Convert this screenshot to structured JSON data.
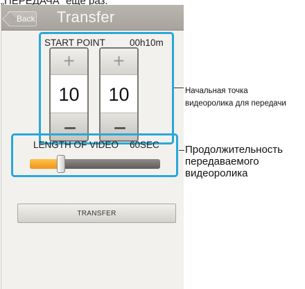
{
  "top_caption": "„ПЕРЕДАЧА“ еще раз.",
  "screen": {
    "title": "Transfer",
    "back_label": "Back",
    "start_point": {
      "label": "START POINT",
      "value": "00h10m",
      "hours_spinner": {
        "value": "10",
        "plus": "+",
        "minus": "−"
      },
      "minutes_spinner": {
        "value": "10",
        "plus": "+",
        "minus": "−"
      }
    },
    "length": {
      "label": "LENGTH OF VIDEO",
      "value": "60SEC",
      "slider_fraction": 0.24
    },
    "transfer_button": "TRANSFER"
  },
  "callouts": [
    {
      "line1": "Начальная точка",
      "line2": "видеоролика для передачи"
    },
    {
      "line1": "Продолжительность",
      "line2": "передаваемого",
      "line3": "видеоролика"
    }
  ],
  "colors": {
    "highlight": "#29a8d9",
    "slider_fill": "#f0941a",
    "titlebar": "#a8a49d"
  }
}
